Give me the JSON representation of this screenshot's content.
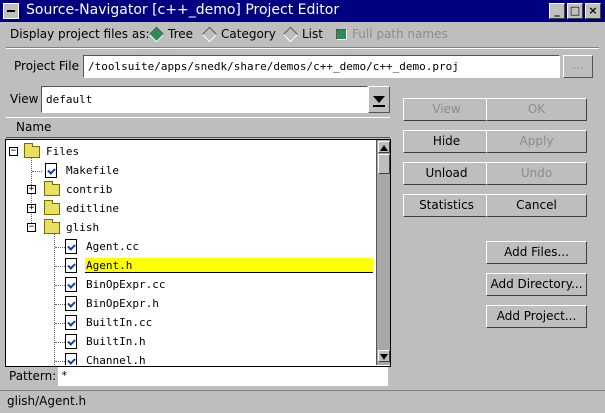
{
  "window": {
    "title": "Source-Navigator [c++_demo] Project Editor",
    "minimize": "_",
    "maximize": "□",
    "close": "×"
  },
  "display": {
    "label": "Display project files as:",
    "tree": "Tree",
    "category": "Category",
    "list": "List",
    "full_path": "Full path names",
    "selected": "Tree",
    "full_path_checked": true
  },
  "project_file": {
    "label": "Project File",
    "value": "/toolsuite/apps/snedk/share/demos/c++_demo/c++_demo.proj",
    "browse_label": "..."
  },
  "view": {
    "label": "View",
    "value": "default"
  },
  "name_header": "Name",
  "tree": {
    "rows": [
      {
        "label": "Files",
        "type": "folder",
        "depth": 0,
        "toggle": "−"
      },
      {
        "label": "Makefile",
        "type": "file",
        "depth": 1
      },
      {
        "label": "contrib",
        "type": "folder",
        "depth": 1,
        "toggle": "+"
      },
      {
        "label": "editline",
        "type": "folder",
        "depth": 1,
        "toggle": "+"
      },
      {
        "label": "glish",
        "type": "folder",
        "depth": 1,
        "toggle": "−"
      },
      {
        "label": "Agent.cc",
        "type": "file",
        "depth": 2
      },
      {
        "label": "Agent.h",
        "type": "file",
        "depth": 2,
        "selected": true
      },
      {
        "label": "BinOpExpr.cc",
        "type": "file",
        "depth": 2
      },
      {
        "label": "BinOpExpr.h",
        "type": "file",
        "depth": 2
      },
      {
        "label": "BuiltIn.cc",
        "type": "file",
        "depth": 2
      },
      {
        "label": "BuiltIn.h",
        "type": "file",
        "depth": 2
      },
      {
        "label": "Channel.h",
        "type": "file",
        "depth": 2
      }
    ]
  },
  "pattern": {
    "label": "Pattern:",
    "value": "*"
  },
  "buttons": {
    "view": "View",
    "ok": "OK",
    "hide": "Hide",
    "apply": "Apply",
    "unload": "Unload",
    "undo": "Undo",
    "statistics": "Statistics",
    "cancel": "Cancel",
    "add_files": "Add Files...",
    "add_directory": "Add Directory...",
    "add_project": "Add Project..."
  },
  "status": "glish/Agent.h",
  "colors": {
    "title_bar": "#000080",
    "selection": "#ffff00",
    "radio_on": "#2e8b57",
    "background": "#bebebe"
  }
}
